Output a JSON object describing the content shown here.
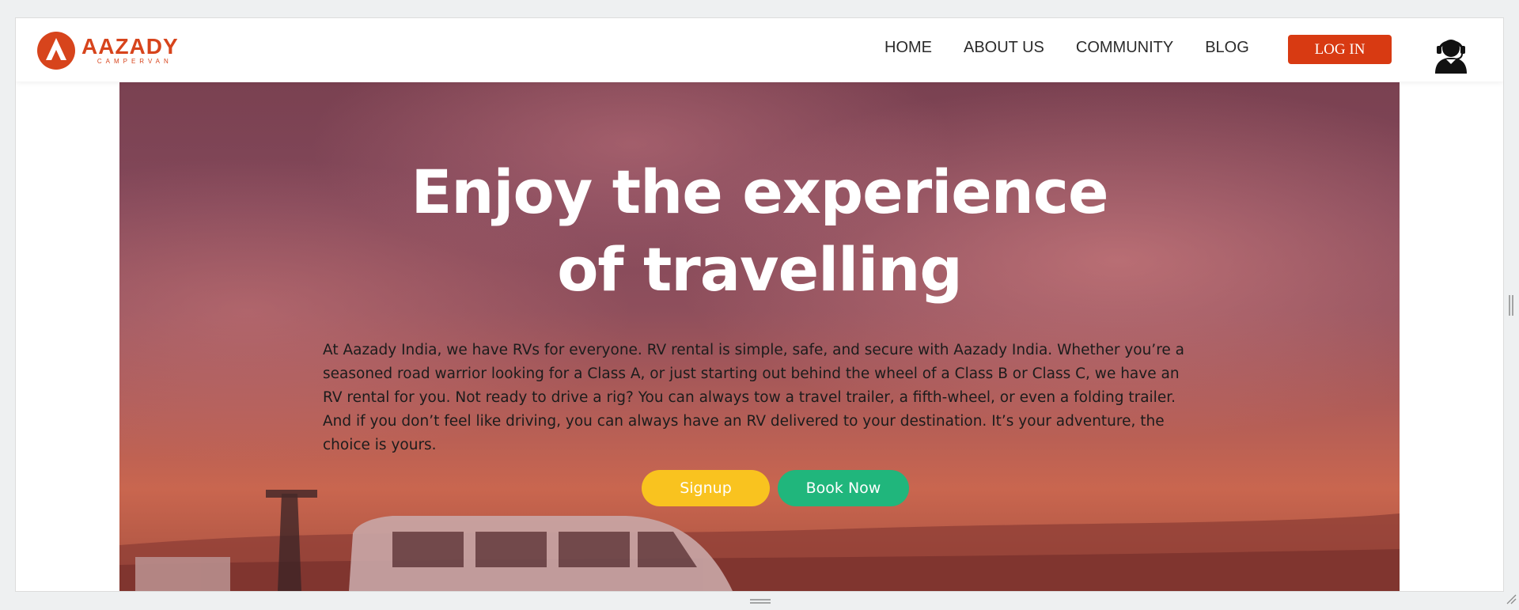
{
  "brand": {
    "name": "AAZADY",
    "tagline": "CAMPERVAN",
    "color": "#d7441c"
  },
  "nav": {
    "links": [
      "HOME",
      "ABOUT US",
      "COMMUNITY",
      "BLOG"
    ],
    "login_label": "LOG IN",
    "support_icon": "headset-user-icon"
  },
  "hero": {
    "title_line1": "Enjoy the experience",
    "title_line2": "of travelling",
    "description": "At Aazady India, we have RVs for everyone. RV rental is simple, safe, and secure with Aazady India. Whether you’re a seasoned road warrior looking for a Class A, or just starting out behind the wheel of a Class B or Class C, we have an RV rental for you. Not ready to drive a rig? You can always tow a travel trailer, a fifth-wheel, or even a folding trailer. And if you don’t feel like driving, you can always have an RV delivered to your destination. It’s your adventure, the choice is yours.",
    "signup_label": "Signup",
    "book_label": "Book Now"
  },
  "colors": {
    "login": "#d83a12",
    "signup": "#f9c31f",
    "book": "#20b67c"
  }
}
